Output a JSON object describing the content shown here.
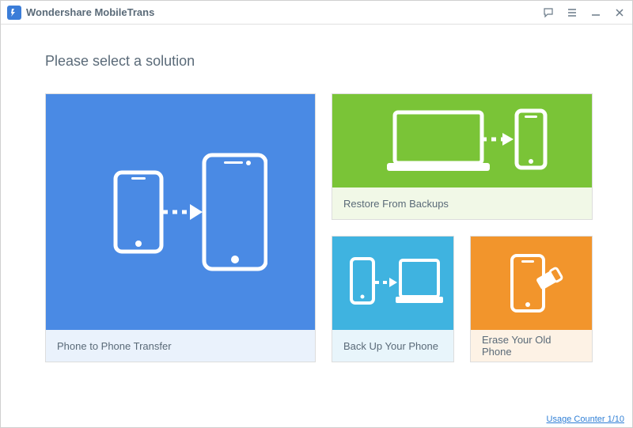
{
  "app": {
    "title": "Wondershare MobileTrans"
  },
  "heading": "Please select a solution",
  "tiles": {
    "transfer": {
      "label": "Phone to Phone Transfer"
    },
    "restore": {
      "label": "Restore From Backups"
    },
    "backup": {
      "label": "Back Up Your Phone"
    },
    "erase": {
      "label": "Erase Your Old Phone"
    }
  },
  "footer": {
    "usage_label": "Usage Counter 1/10"
  },
  "colors": {
    "blue": "#4a8ae4",
    "green": "#7ac437",
    "cyan": "#3fb3e0",
    "orange": "#f2952c"
  }
}
